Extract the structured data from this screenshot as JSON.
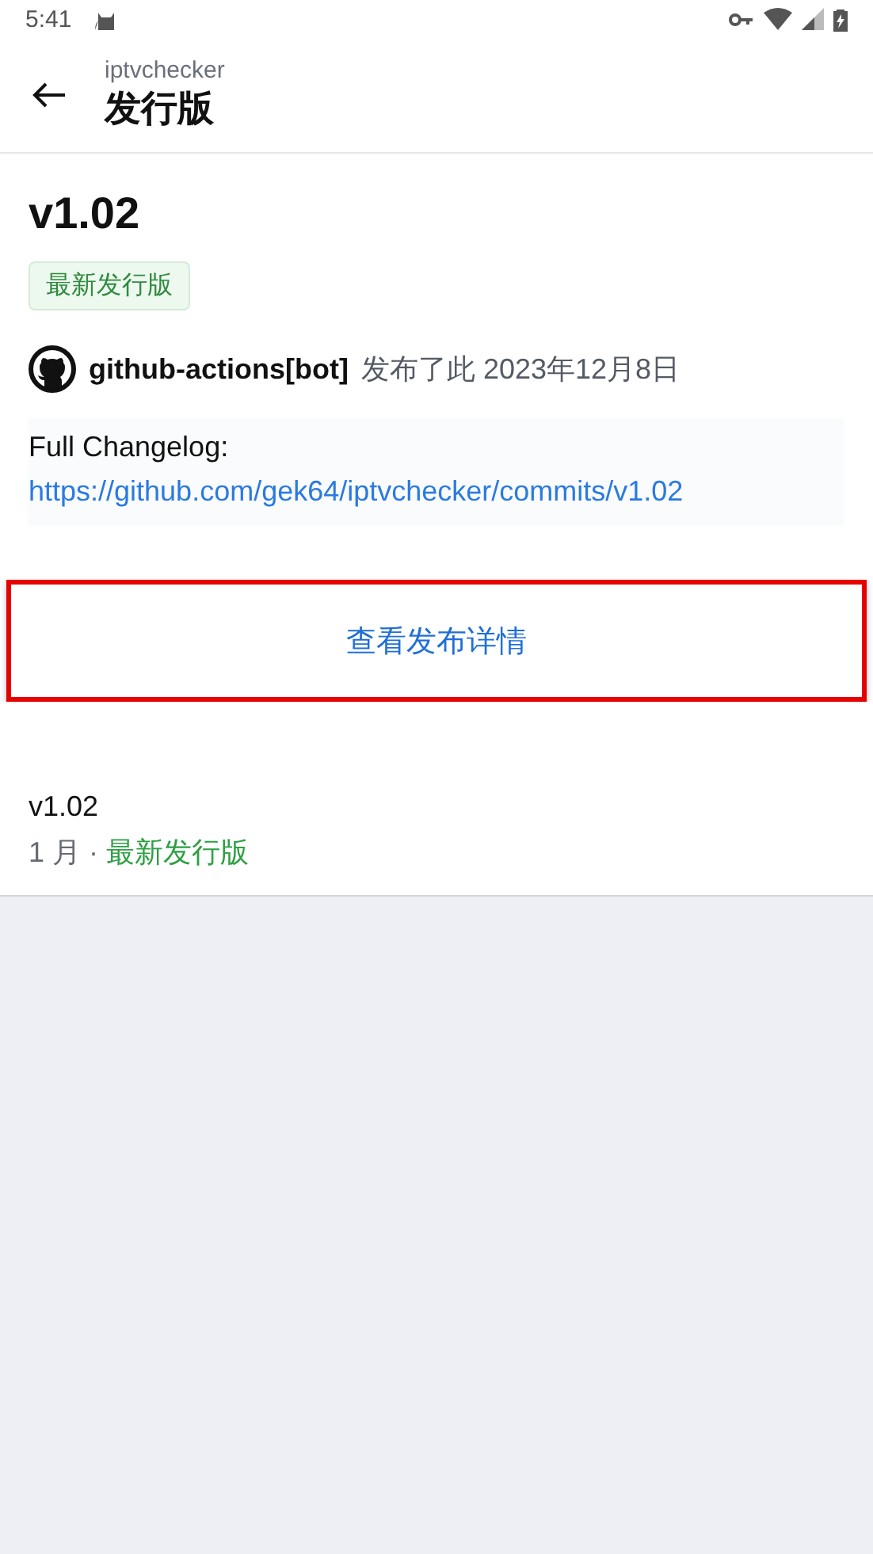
{
  "status_bar": {
    "time": "5:41"
  },
  "header": {
    "subtitle": "iptvchecker",
    "title": "发行版"
  },
  "release": {
    "version": "v1.02",
    "badge": "最新发行版",
    "author": "github-actions[bot]",
    "published": "发布了此 2023年12月8日",
    "changelog_label": "Full Changelog:",
    "changelog_link": "https://github.com/gek64/iptvchecker/commits/v1.02"
  },
  "details_button": {
    "label": "查看发布详情",
    "highlighted": true
  },
  "release_list": [
    {
      "version": "v1.02",
      "age": "1 月",
      "separator": "·",
      "tag": "最新发行版"
    }
  ]
}
